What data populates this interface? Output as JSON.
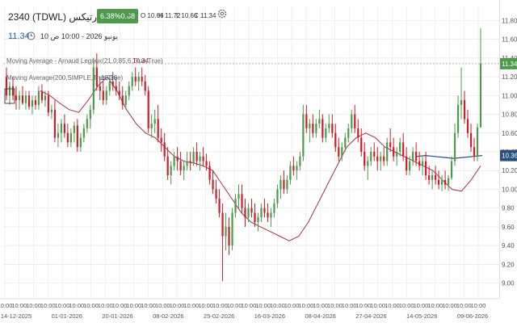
{
  "header": {
    "symbol_title": "2340 (TDWL) ارتيكس",
    "change_badge": "6.38%0.68",
    "ohlc": {
      "open": "O 10.66",
      "high": "H 11.72",
      "low": "L 10.66",
      "close": "C 11.34"
    },
    "last_price": "11.34",
    "timestamp": "يونيو 2026 - 10:00 ص 10"
  },
  "indicators": [
    {
      "label": "Moving Average - Arnaud Legoux(21,0.85,6,True,True)",
      "value": "10.34",
      "color": "#a33050"
    },
    {
      "label": "Moving Average(200,SIMPLE,True,True)",
      "value": "10.36",
      "color": "#2a4f7a"
    }
  ],
  "colors": {
    "up": "#4e9a4a",
    "down": "#c8202a",
    "ma_alma": "#a33050",
    "ma_sma": "#2a4f7a",
    "grid": "#e8e8e8",
    "last_price_label": "#4e9a4a",
    "sma_label": "#2a4f7a"
  },
  "chart_data": {
    "type": "candlestick",
    "ylim": [
      8.85,
      11.95
    ],
    "y_ticks": [
      9.0,
      9.2,
      9.4,
      9.6,
      9.8,
      10.0,
      10.2,
      10.4,
      10.6,
      10.8,
      11.0,
      11.2,
      11.4,
      11.6,
      11.8
    ],
    "y_tick_labels": [
      "9.00",
      "9.20",
      "9.40",
      "9.60",
      "9.80",
      "10.00",
      "10.20",
      "10.40",
      "10.60",
      "10.80",
      "11.00",
      "11.20",
      "11.40",
      "11.60",
      "11.80"
    ],
    "last_price_label": "11.34",
    "sma_label": "10.36",
    "date_labels": [
      "14-12-2025",
      "01-01-2026",
      "20-01-2026",
      "08-02-2026",
      "25-02-2026",
      "16-03-2026",
      "08-04-2026",
      "27-04-2026",
      "14-05-2026",
      "09-06-2026"
    ],
    "time_tick_label": "10:00",
    "time_tick_count": 34,
    "candles": [
      [
        11.2,
        11.3,
        10.95,
        11.0
      ],
      [
        11.0,
        11.15,
        10.9,
        11.1
      ],
      [
        11.1,
        11.2,
        10.95,
        11.0
      ],
      [
        11.0,
        11.1,
        10.85,
        10.95
      ],
      [
        10.95,
        11.05,
        10.85,
        11.0
      ],
      [
        11.0,
        11.1,
        10.9,
        10.92
      ],
      [
        10.92,
        11.05,
        10.85,
        11.0
      ],
      [
        11.0,
        11.05,
        10.85,
        10.88
      ],
      [
        10.88,
        11.0,
        10.8,
        10.95
      ],
      [
        10.95,
        11.0,
        10.85,
        10.9
      ],
      [
        10.9,
        11.1,
        10.85,
        11.05
      ],
      [
        11.05,
        11.12,
        10.92,
        10.95
      ],
      [
        10.95,
        11.05,
        10.88,
        11.0
      ],
      [
        11.0,
        11.05,
        10.78,
        10.82
      ],
      [
        10.82,
        10.9,
        10.75,
        10.85
      ],
      [
        10.85,
        10.95,
        10.5,
        10.55
      ],
      [
        10.55,
        10.7,
        10.45,
        10.6
      ],
      [
        10.6,
        10.75,
        10.5,
        10.7
      ],
      [
        10.7,
        10.8,
        10.55,
        10.6
      ],
      [
        10.6,
        10.7,
        10.45,
        10.5
      ],
      [
        10.5,
        10.65,
        10.45,
        10.6
      ],
      [
        10.6,
        10.72,
        10.5,
        10.68
      ],
      [
        10.68,
        10.75,
        10.4,
        10.45
      ],
      [
        10.45,
        10.6,
        10.4,
        10.55
      ],
      [
        10.55,
        10.7,
        10.5,
        10.65
      ],
      [
        10.65,
        10.8,
        10.6,
        10.75
      ],
      [
        10.75,
        10.9,
        10.65,
        10.85
      ],
      [
        10.85,
        11.4,
        10.8,
        11.3
      ],
      [
        11.3,
        11.45,
        11.05,
        11.1
      ],
      [
        11.1,
        11.2,
        10.95,
        11.05
      ],
      [
        11.05,
        11.15,
        10.9,
        10.95
      ],
      [
        10.95,
        11.1,
        10.9,
        11.05
      ],
      [
        11.05,
        11.2,
        11.0,
        11.15
      ],
      [
        11.15,
        11.25,
        11.05,
        11.1
      ],
      [
        11.1,
        11.2,
        11.0,
        11.05
      ],
      [
        11.05,
        11.15,
        10.95,
        11.0
      ],
      [
        11.0,
        11.1,
        10.85,
        10.9
      ],
      [
        10.9,
        11.05,
        10.85,
        11.0
      ],
      [
        11.0,
        11.15,
        10.95,
        11.1
      ],
      [
        11.1,
        11.25,
        11.05,
        11.2
      ],
      [
        11.2,
        11.3,
        11.1,
        11.15
      ],
      [
        11.15,
        11.25,
        11.05,
        11.2
      ],
      [
        11.2,
        11.3,
        11.1,
        11.15
      ],
      [
        11.15,
        11.22,
        11.0,
        11.05
      ],
      [
        11.05,
        11.1,
        10.6,
        10.65
      ],
      [
        10.65,
        10.8,
        10.55,
        10.7
      ],
      [
        10.7,
        10.85,
        10.6,
        10.75
      ],
      [
        10.75,
        10.9,
        10.5,
        10.55
      ],
      [
        10.55,
        10.65,
        10.4,
        10.5
      ],
      [
        10.5,
        10.6,
        10.3,
        10.35
      ],
      [
        10.35,
        10.45,
        10.1,
        10.15
      ],
      [
        10.15,
        10.3,
        10.05,
        10.25
      ],
      [
        10.25,
        10.4,
        10.2,
        10.35
      ],
      [
        10.35,
        10.45,
        10.2,
        10.3
      ],
      [
        10.3,
        10.4,
        10.15,
        10.2
      ],
      [
        10.2,
        10.3,
        10.1,
        10.25
      ],
      [
        10.25,
        10.4,
        10.2,
        10.3
      ],
      [
        10.3,
        10.4,
        10.2,
        10.28
      ],
      [
        10.28,
        10.45,
        10.25,
        10.4
      ],
      [
        10.4,
        10.5,
        10.25,
        10.3
      ],
      [
        10.3,
        10.4,
        10.2,
        10.35
      ],
      [
        10.35,
        10.45,
        10.25,
        10.3
      ],
      [
        10.3,
        10.38,
        10.2,
        10.25
      ],
      [
        10.25,
        10.3,
        10.05,
        10.1
      ],
      [
        10.1,
        10.2,
        9.95,
        10.0
      ],
      [
        10.0,
        10.1,
        9.85,
        9.9
      ],
      [
        9.9,
        10.0,
        9.7,
        9.75
      ],
      [
        9.75,
        9.85,
        9.02,
        9.5
      ],
      [
        9.5,
        9.75,
        9.35,
        9.6
      ],
      [
        9.6,
        9.7,
        9.3,
        9.4
      ],
      [
        9.4,
        9.8,
        9.35,
        9.75
      ],
      [
        9.75,
        9.95,
        9.7,
        9.9
      ],
      [
        9.9,
        10.05,
        9.8,
        9.95
      ],
      [
        9.95,
        10.05,
        9.75,
        9.8
      ],
      [
        9.8,
        9.9,
        9.6,
        9.7
      ],
      [
        9.7,
        9.85,
        9.65,
        9.8
      ],
      [
        9.8,
        9.9,
        9.7,
        9.75
      ],
      [
        9.75,
        9.85,
        9.6,
        9.65
      ],
      [
        9.65,
        9.75,
        9.55,
        9.7
      ],
      [
        9.7,
        9.85,
        9.65,
        9.8
      ],
      [
        9.8,
        9.9,
        9.7,
        9.75
      ],
      [
        9.75,
        9.85,
        9.65,
        9.7
      ],
      [
        9.7,
        9.8,
        9.6,
        9.75
      ],
      [
        9.75,
        9.9,
        9.7,
        9.85
      ],
      [
        9.85,
        10.05,
        9.8,
        10.0
      ],
      [
        10.0,
        10.15,
        9.9,
        10.1
      ],
      [
        10.1,
        10.2,
        9.95,
        10.0
      ],
      [
        10.0,
        10.15,
        9.95,
        10.1
      ],
      [
        10.1,
        10.3,
        10.05,
        10.25
      ],
      [
        10.25,
        10.35,
        10.15,
        10.2
      ],
      [
        10.2,
        10.3,
        10.1,
        10.25
      ],
      [
        10.25,
        10.4,
        10.2,
        10.35
      ],
      [
        10.35,
        10.9,
        10.3,
        10.8
      ],
      [
        10.8,
        10.9,
        10.6,
        10.65
      ],
      [
        10.65,
        10.75,
        10.5,
        10.7
      ],
      [
        10.7,
        10.8,
        10.55,
        10.6
      ],
      [
        10.6,
        10.75,
        10.55,
        10.7
      ],
      [
        10.7,
        10.85,
        10.65,
        10.75
      ],
      [
        10.75,
        10.8,
        10.5,
        10.55
      ],
      [
        10.55,
        10.7,
        10.5,
        10.65
      ],
      [
        10.65,
        10.8,
        10.6,
        10.7
      ],
      [
        10.7,
        10.8,
        10.55,
        10.6
      ],
      [
        10.6,
        10.7,
        10.4,
        10.45
      ],
      [
        10.45,
        10.55,
        10.3,
        10.35
      ],
      [
        10.35,
        10.5,
        10.3,
        10.45
      ],
      [
        10.45,
        10.6,
        10.4,
        10.55
      ],
      [
        10.55,
        10.7,
        10.5,
        10.65
      ],
      [
        10.65,
        10.85,
        10.6,
        10.8
      ],
      [
        10.8,
        10.9,
        10.6,
        10.65
      ],
      [
        10.65,
        10.75,
        10.5,
        10.55
      ],
      [
        10.55,
        10.65,
        10.35,
        10.4
      ],
      [
        10.4,
        10.5,
        10.2,
        10.25
      ],
      [
        10.25,
        10.35,
        10.1,
        10.3
      ],
      [
        10.3,
        10.45,
        10.25,
        10.4
      ],
      [
        10.4,
        10.5,
        10.3,
        10.35
      ],
      [
        10.35,
        10.45,
        10.2,
        10.3
      ],
      [
        10.3,
        10.4,
        10.2,
        10.35
      ],
      [
        10.35,
        10.45,
        10.25,
        10.3
      ],
      [
        10.3,
        10.55,
        10.25,
        10.5
      ],
      [
        10.5,
        10.65,
        10.4,
        10.45
      ],
      [
        10.45,
        10.55,
        10.3,
        10.35
      ],
      [
        10.35,
        10.45,
        10.25,
        10.4
      ],
      [
        10.4,
        10.55,
        10.35,
        10.5
      ],
      [
        10.5,
        10.6,
        10.3,
        10.35
      ],
      [
        10.35,
        10.45,
        10.15,
        10.2
      ],
      [
        10.2,
        10.35,
        10.15,
        10.3
      ],
      [
        10.3,
        10.45,
        10.25,
        10.4
      ],
      [
        10.4,
        10.5,
        10.25,
        10.3
      ],
      [
        10.3,
        10.4,
        10.2,
        10.25
      ],
      [
        10.25,
        10.35,
        10.15,
        10.3
      ],
      [
        10.3,
        10.4,
        10.1,
        10.15
      ],
      [
        10.15,
        10.25,
        10.05,
        10.1
      ],
      [
        10.1,
        10.2,
        10.0,
        10.15
      ],
      [
        10.15,
        10.25,
        10.05,
        10.1
      ],
      [
        10.1,
        10.2,
        10.0,
        10.05
      ],
      [
        10.05,
        10.15,
        9.98,
        10.1
      ],
      [
        10.1,
        10.2,
        10.0,
        10.05
      ],
      [
        10.05,
        10.15,
        9.98,
        10.12
      ],
      [
        10.12,
        10.35,
        10.1,
        10.3
      ],
      [
        10.3,
        10.7,
        10.25,
        10.6
      ],
      [
        10.6,
        11.0,
        10.55,
        10.9
      ],
      [
        10.9,
        11.3,
        10.75,
        10.95
      ],
      [
        10.95,
        11.05,
        10.7,
        10.75
      ],
      [
        10.75,
        10.85,
        10.55,
        10.6
      ],
      [
        10.6,
        10.7,
        10.4,
        10.45
      ],
      [
        10.45,
        10.55,
        10.3,
        10.35
      ],
      [
        10.35,
        10.7,
        10.3,
        10.66
      ],
      [
        10.66,
        11.72,
        10.66,
        11.34
      ]
    ],
    "ma_alma": [
      11.05,
      11.0,
      10.92,
      10.85,
      10.82,
      10.95,
      11.1,
      11.2,
      11.05,
      10.85,
      10.7,
      10.6,
      10.55,
      10.45,
      10.35,
      10.3,
      10.28,
      10.25,
      10.2,
      10.05,
      9.9,
      9.75,
      9.65,
      9.6,
      9.55,
      9.5,
      9.45,
      9.5,
      9.65,
      9.85,
      10.05,
      10.25,
      10.45,
      10.55,
      10.6,
      10.55,
      10.45,
      10.4,
      10.35,
      10.3,
      10.25,
      10.2,
      10.1,
      10.0,
      9.98,
      10.1,
      10.25
    ],
    "ma_sma": [
      10.35,
      10.36,
      10.35,
      10.34,
      10.33,
      10.34,
      10.35,
      10.36
    ]
  }
}
